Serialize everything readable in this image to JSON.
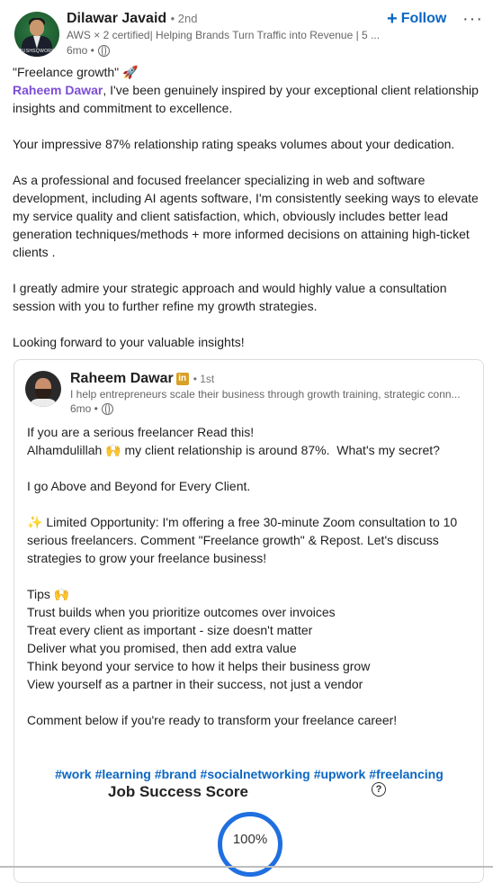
{
  "author": {
    "name": "Dilawar Javaid",
    "degree": "• 2nd",
    "tagline": "AWS × 2 certified| Helping Brands Turn Traffic into Revenue | 5 ...",
    "time": "6mo •",
    "avatar_text": "PUSHSQWORK"
  },
  "actions": {
    "follow_label": "Follow",
    "follow_icon": "+",
    "more_label": "···"
  },
  "post_body": {
    "line1": "\"Freelance growth\" 🚀",
    "mention": "Raheem Dawar",
    "after_mention": ", I've been genuinely inspired by your exceptional client relationship insights and commitment to excellence.",
    "p2": "Your impressive 87% relationship rating speaks volumes about your dedication.",
    "p3": "As a professional and focused freelancer specializing in web and software development, including AI agents software, I'm consistently seeking ways to elevate my service quality and client satisfaction, which, obviously includes better lead generation techniques/methods + more informed decisions on attaining high-ticket clients .",
    "p4": "I greatly admire your strategic approach and would highly value a consultation session with you to further refine my growth strategies.",
    "p5": "Looking forward to your valuable insights!"
  },
  "shared": {
    "name": "Raheem Dawar",
    "badge": "in",
    "degree": "• 1st",
    "tagline": "I help entrepreneurs scale their business through growth training, strategic conn...",
    "time": "6mo •",
    "p1": "If you are a serious freelancer Read this!\nAlhamdulillah 🙌 my client relationship is around 87%.  What's my secret?",
    "p2": "I go Above and Beyond for Every Client.",
    "p3": "✨ Limited Opportunity: I'm offering a free 30-minute Zoom consultation to 10 serious freelancers. Comment \"Freelance growth\" & Repost. Let's discuss strategies to grow your freelance business!",
    "p4": "Tips 🙌\nTrust builds when you prioritize outcomes over invoices\nTreat every client as important - size doesn't matter\nDeliver what you promised, then add extra value\nThink beyond your service to how it helps their business grow\nView yourself as a partner in their success, not just a vendor",
    "p5": "Comment below if you're ready to transform your freelance career!",
    "hashtags": [
      "#work",
      "#learning",
      "#brand",
      "#socialnetworking",
      "#upwork",
      "#freelancing"
    ],
    "image": {
      "title": "Job Success Score",
      "help": "?",
      "score": "100%"
    }
  },
  "colors": {
    "accent": "#0a66c2",
    "mention": "#7c4dd6",
    "ring": "#1f6fe0"
  },
  "icons": [
    "globe-icon",
    "more-icon",
    "plus-icon",
    "linkedin-badge-icon",
    "help-icon"
  ]
}
